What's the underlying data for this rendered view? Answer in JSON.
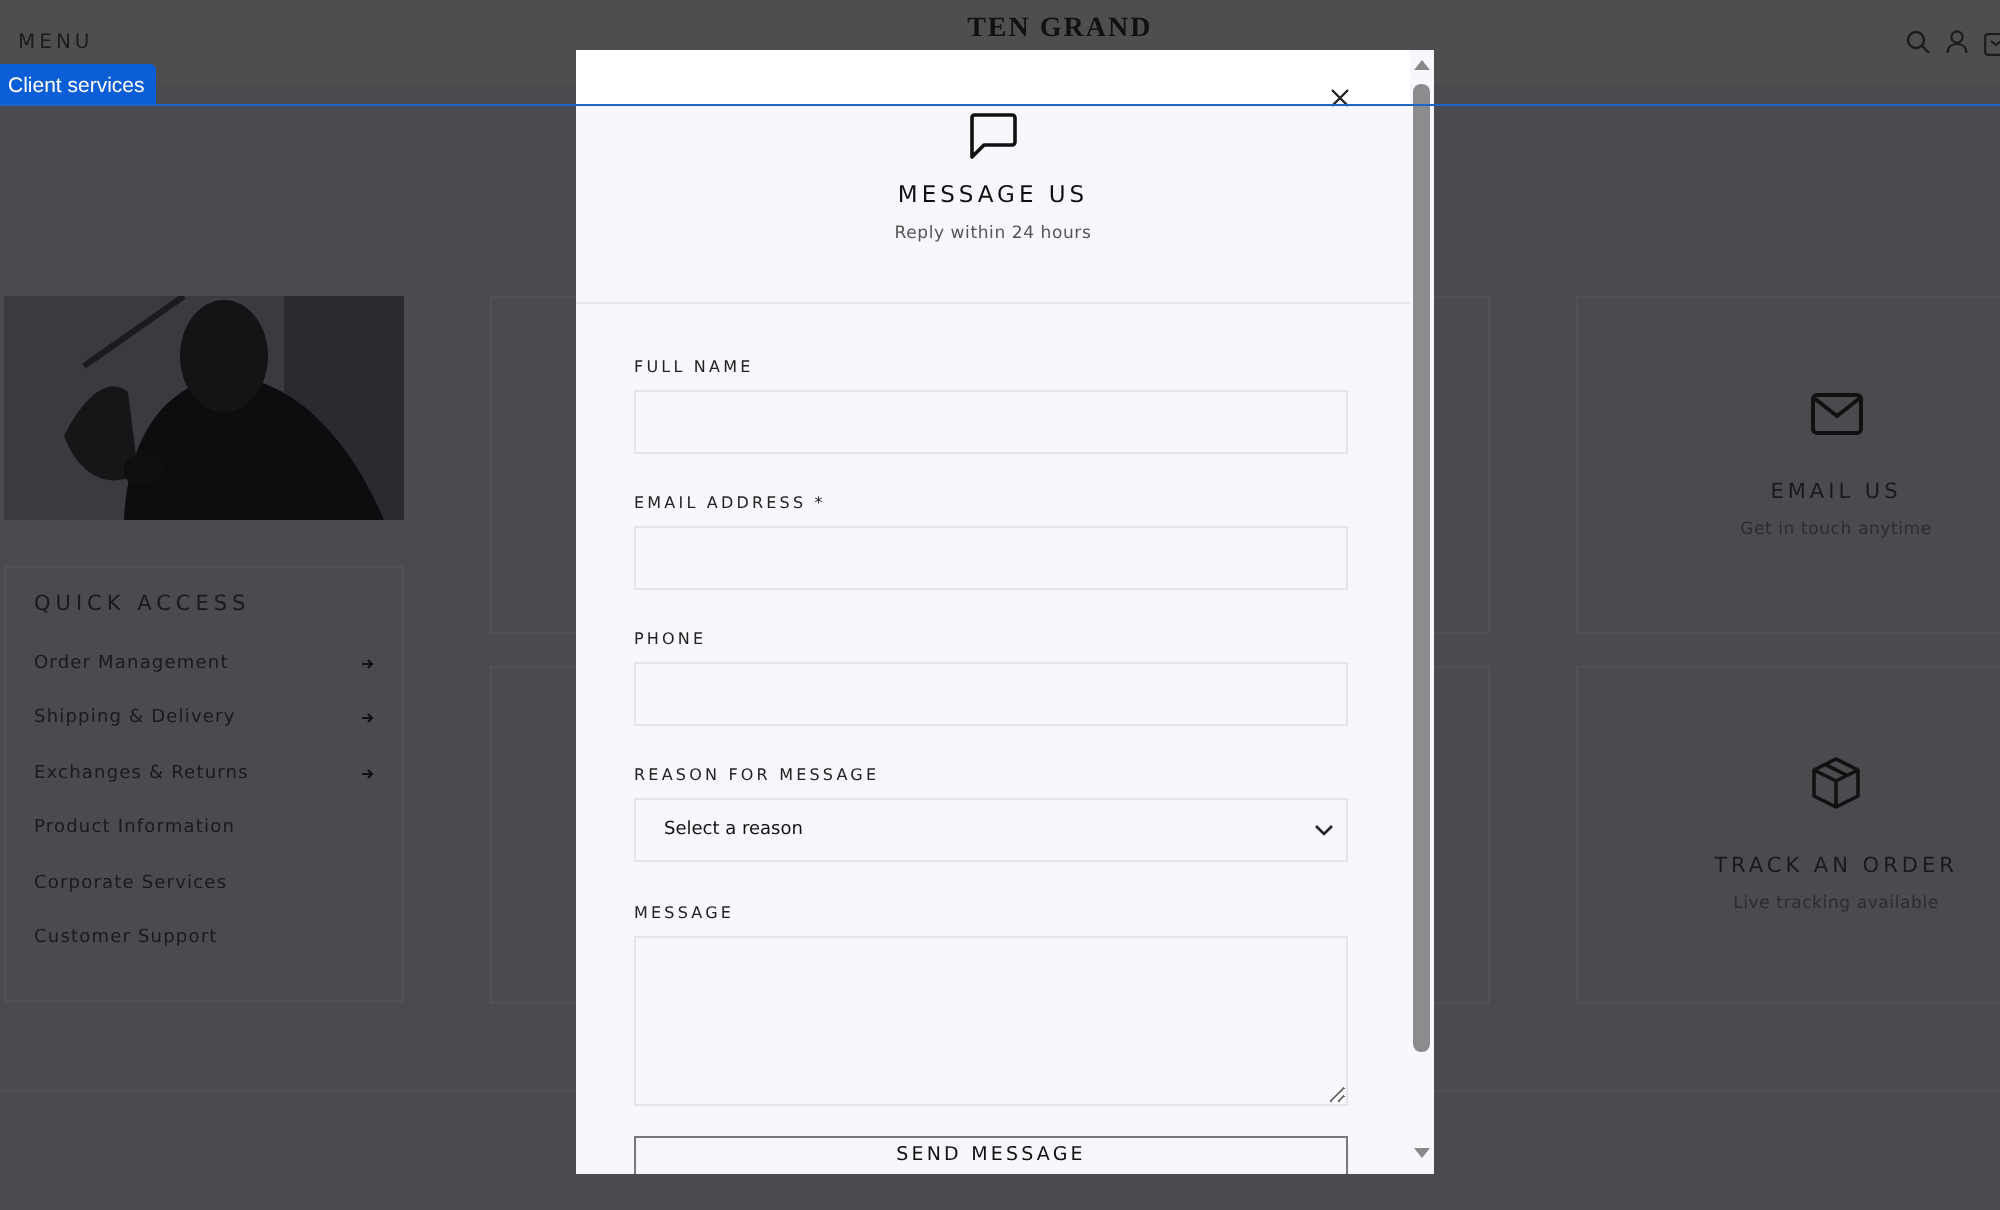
{
  "header": {
    "menu_label": "MENU",
    "logo": "TEN GRAND"
  },
  "client_services_tab": {
    "label": "Client services"
  },
  "quick_access": {
    "title": "QUICK ACCESS",
    "items": [
      {
        "label": "Order Management",
        "arrow": true
      },
      {
        "label": "Shipping & Delivery",
        "arrow": true
      },
      {
        "label": "Exchanges & Returns",
        "arrow": true
      },
      {
        "label": "Product Information",
        "arrow": false
      },
      {
        "label": "Corporate Services",
        "arrow": false
      },
      {
        "label": "Customer Support",
        "arrow": false
      }
    ]
  },
  "side_cards": [
    {
      "kind": "email",
      "title": "EMAIL US",
      "subtitle": "Get in touch anytime"
    },
    {
      "kind": "package",
      "title": "TRACK AN ORDER",
      "subtitle": "Live tracking available"
    }
  ],
  "modal": {
    "title": "MESSAGE US",
    "subtitle": "Reply within 24 hours",
    "fields": [
      {
        "kind": "text",
        "label": "FULL NAME"
      },
      {
        "kind": "text",
        "label": "EMAIL ADDRESS *"
      },
      {
        "kind": "text",
        "label": "PHONE"
      },
      {
        "kind": "select",
        "label": "REASON FOR MESSAGE",
        "value": "Select a reason"
      },
      {
        "kind": "textarea",
        "label": "MESSAGE"
      }
    ],
    "submit_label": "SEND MESSAGE"
  }
}
